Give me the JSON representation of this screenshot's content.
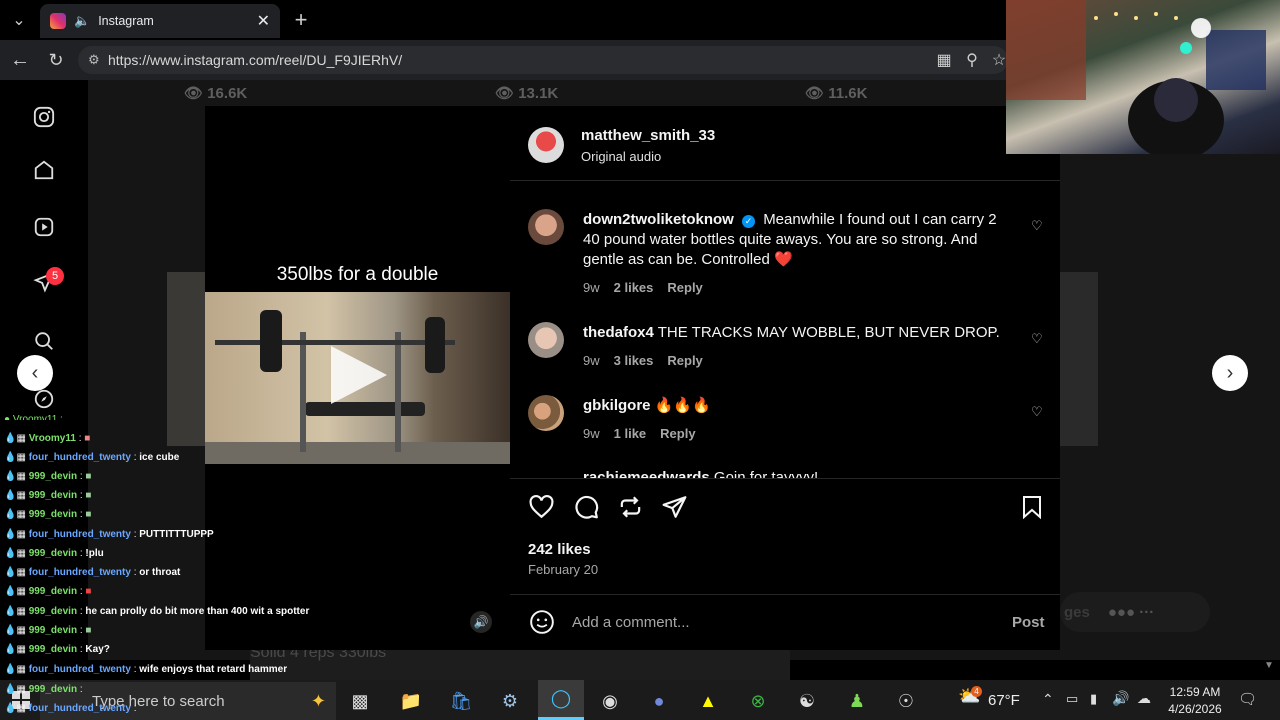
{
  "browser": {
    "tab_title": "Instagram",
    "url": "https://www.instagram.com/reel/DU_F9JIERhV/"
  },
  "reels_bar": {
    "views": [
      "16.6K",
      "13.1K",
      "11.6K"
    ]
  },
  "sidebar": {
    "notification_count": "5"
  },
  "video": {
    "title_text": "350lbs for a double",
    "caption_behind": "Solid 4 reps 330lbs"
  },
  "post": {
    "username": "matthew_smith_33",
    "audio": "Original audio",
    "likes": "242 likes",
    "date": "February 20",
    "comment_placeholder": "Add a comment...",
    "post_label": "Post"
  },
  "comments": [
    {
      "user": "down2twoliketoknow",
      "text": "Meanwhile I found out I can carry 2 40 pound water bottles quite aways. You are so strong. And gentle as can be. Controlled ❤️",
      "age": "9w",
      "likes": "2 likes",
      "reply": "Reply"
    },
    {
      "user": "thedafox4",
      "text": "THE TRACKS MAY WOBBLE, BUT NEVER DROP.",
      "age": "9w",
      "likes": "3 likes",
      "reply": "Reply"
    },
    {
      "user": "gbkilgore",
      "text": "🔥🔥🔥",
      "age": "9w",
      "likes": "1 like",
      "reply": "Reply"
    },
    {
      "user": "rachiemeedwards",
      "text": "Goin for tayyyy!"
    }
  ],
  "chat": [
    {
      "name": "Vroomy11",
      "msg": ""
    },
    {
      "name": "four_hundred_twenty",
      "msg": "ice cube"
    },
    {
      "name": "999_devin",
      "msg": ""
    },
    {
      "name": "999_devin",
      "msg": ""
    },
    {
      "name": "999_devin",
      "msg": ""
    },
    {
      "name": "four_hundred_twenty",
      "msg": "PUTTITTTUPPP"
    },
    {
      "name": "999_devin",
      "msg": "!plu"
    },
    {
      "name": "four_hundred_twenty",
      "msg": "or throat"
    },
    {
      "name": "999_devin",
      "msg": ""
    },
    {
      "name": "999_devin",
      "msg": "he can prolly do bit more than 400 wit a spotter"
    },
    {
      "name": "999_devin",
      "msg": ""
    },
    {
      "name": "999_devin",
      "msg": "Kay?"
    },
    {
      "name": "four_hundred_twenty",
      "msg": "wife enjoys that retard hammer"
    },
    {
      "name": "999_devin",
      "msg": ""
    },
    {
      "name": "four_hundred_twenty",
      "msg": ""
    }
  ],
  "taskbar": {
    "search_placeholder": "Type here to search",
    "weather_temp": "67°F",
    "weather_badge": "4",
    "time": "12:59 AM",
    "date": "4/26/2026"
  },
  "colors": {
    "ig_blue": "#0095f6",
    "heart_red": "#ff3040"
  }
}
